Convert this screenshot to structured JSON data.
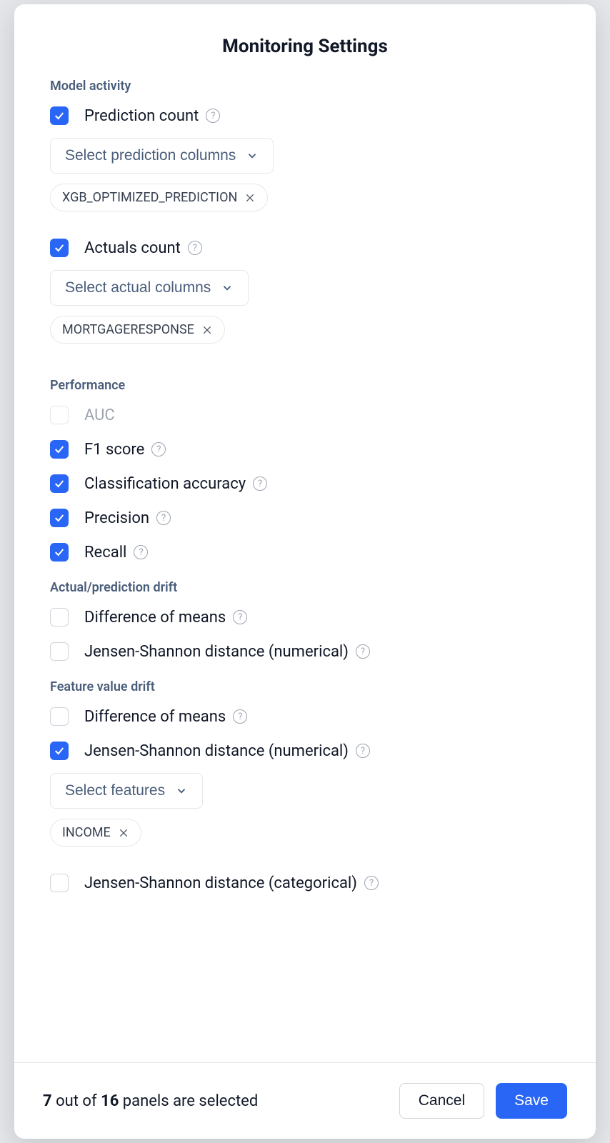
{
  "modal": {
    "title": "Monitoring Settings"
  },
  "sections": {
    "modelActivity": {
      "title": "Model activity",
      "predictionCount": {
        "label": "Prediction count",
        "selectLabel": "Select prediction columns",
        "chip": "XGB_OPTIMIZED_PREDICTION"
      },
      "actualsCount": {
        "label": "Actuals count",
        "selectLabel": "Select actual columns",
        "chip": "MORTGAGERESPONSE"
      }
    },
    "performance": {
      "title": "Performance",
      "auc": "AUC",
      "f1": "F1 score",
      "accuracy": "Classification accuracy",
      "precision": "Precision",
      "recall": "Recall"
    },
    "actualPredictionDrift": {
      "title": "Actual/prediction drift",
      "diffMeans": "Difference of means",
      "jsNumerical": "Jensen-Shannon distance (numerical)"
    },
    "featureValueDrift": {
      "title": "Feature value drift",
      "diffMeans": "Difference of means",
      "jsNumerical": "Jensen-Shannon distance (numerical)",
      "selectLabel": "Select features",
      "chip": "INCOME",
      "jsCategorical": "Jensen-Shannon distance (categorical)"
    }
  },
  "footer": {
    "selected": "7",
    "outOf": " out of ",
    "total": "16",
    "suffix": " panels are selected",
    "cancel": "Cancel",
    "save": "Save"
  }
}
